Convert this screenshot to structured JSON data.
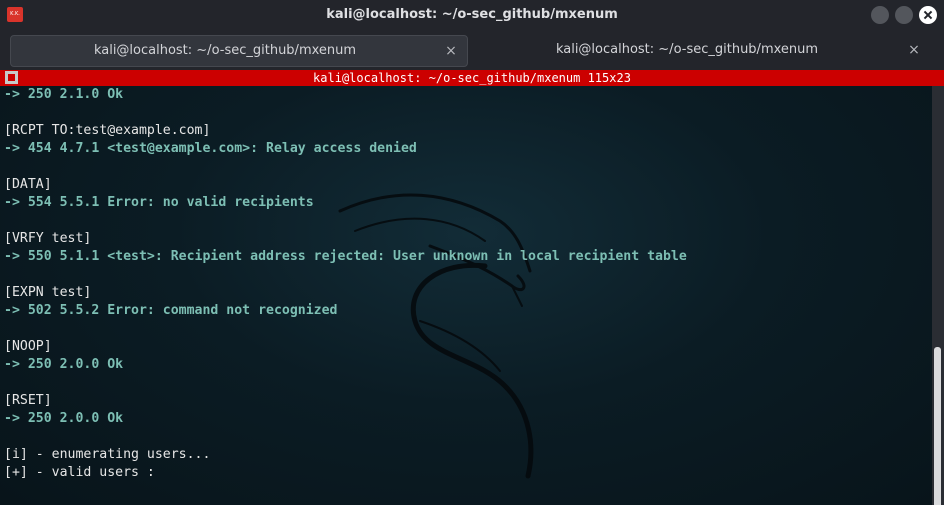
{
  "window": {
    "title": "kali@localhost: ~/o-sec_github/mxenum",
    "app_icon_text": "K.K."
  },
  "tabs": [
    {
      "label": "kali@localhost: ~/o-sec_github/mxenum",
      "close": "×"
    },
    {
      "label": "kali@localhost: ~/o-sec_github/mxenum",
      "close": "×"
    }
  ],
  "terminal_header": {
    "text": "kali@localhost: ~/o-sec_github/mxenum 115x23"
  },
  "terminal": {
    "lines": [
      {
        "type": "resp",
        "text": "-> 250 2.1.0 Ok"
      },
      {
        "type": "blank",
        "text": ""
      },
      {
        "type": "cmd",
        "text": "[RCPT TO:test@example.com]"
      },
      {
        "type": "resp",
        "text": "-> 454 4.7.1 <test@example.com>: Relay access denied"
      },
      {
        "type": "blank",
        "text": ""
      },
      {
        "type": "cmd",
        "text": "[DATA]"
      },
      {
        "type": "resp",
        "text": "-> 554 5.5.1 Error: no valid recipients"
      },
      {
        "type": "blank",
        "text": ""
      },
      {
        "type": "cmd",
        "text": "[VRFY test]"
      },
      {
        "type": "resp",
        "text": "-> 550 5.1.1 <test>: Recipient address rejected: User unknown in local recipient table"
      },
      {
        "type": "blank",
        "text": ""
      },
      {
        "type": "cmd",
        "text": "[EXPN test]"
      },
      {
        "type": "resp",
        "text": "-> 502 5.5.2 Error: command not recognized"
      },
      {
        "type": "blank",
        "text": ""
      },
      {
        "type": "cmd",
        "text": "[NOOP]"
      },
      {
        "type": "resp",
        "text": "-> 250 2.0.0 Ok"
      },
      {
        "type": "blank",
        "text": ""
      },
      {
        "type": "cmd",
        "text": "[RSET]"
      },
      {
        "type": "resp",
        "text": "-> 250 2.0.0 Ok"
      },
      {
        "type": "blank",
        "text": ""
      },
      {
        "type": "info",
        "text": "[i] - enumerating users..."
      },
      {
        "type": "info",
        "text": "[+] - valid users :"
      }
    ]
  },
  "colors": {
    "header_bar": "#cc0000",
    "response_text": "#7dbfb4",
    "command_text": "#e6e6e6",
    "terminal_bg": "#0b1c24"
  }
}
